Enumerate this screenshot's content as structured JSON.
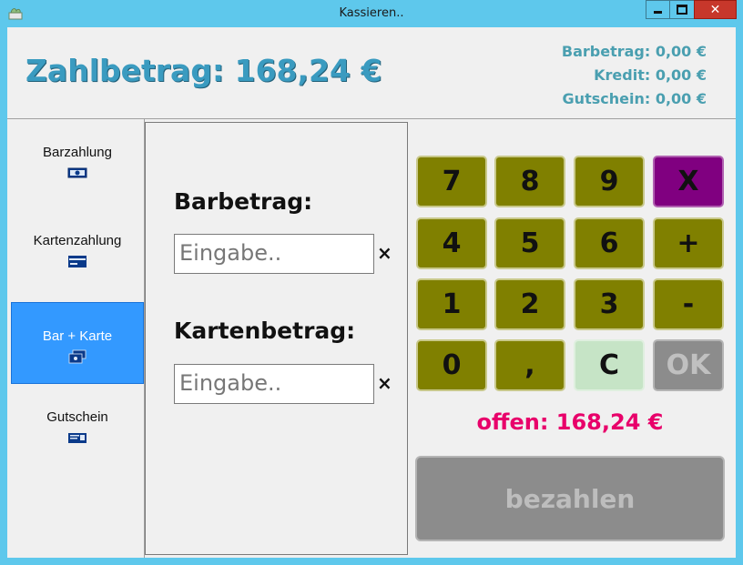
{
  "window": {
    "title": "Kassieren..",
    "close_glyph": "✕"
  },
  "header": {
    "zahlbetrag": "Zahlbetrag: 168,24 €",
    "barbetrag": "Barbetrag: 0,00 €",
    "kredit": "Kredit: 0,00 €",
    "gutschein": "Gutschein: 0,00 €"
  },
  "sidebar": {
    "items": [
      {
        "label": "Barzahlung",
        "icon": "cash-icon",
        "active": false
      },
      {
        "label": "Kartenzahlung",
        "icon": "card-icon",
        "active": false
      },
      {
        "label": "Bar + Karte",
        "icon": "cash-card-icon",
        "active": true
      },
      {
        "label": "Gutschein",
        "icon": "voucher-icon",
        "active": false
      }
    ]
  },
  "form": {
    "barbetrag_label": "Barbetrag:",
    "barbetrag_placeholder": "Eingabe..",
    "kartenbetrag_label": "Kartenbetrag:",
    "kartenbetrag_placeholder": "Eingabe..",
    "clear_glyph": "×"
  },
  "keypad": {
    "keys": [
      "7",
      "8",
      "9",
      "X",
      "4",
      "5",
      "6",
      "+",
      "1",
      "2",
      "3",
      "-",
      "0",
      ",",
      "C",
      "OK"
    ]
  },
  "status": {
    "offen": "offen: 168,24 €"
  },
  "actions": {
    "pay_label": "bezahlen"
  },
  "colors": {
    "titlebar": "#5ec8ec",
    "key_olive": "#808000",
    "key_purple": "#800080",
    "key_clear": "#c6e4c6",
    "disabled_gray": "#8c8c8c",
    "offen_pink": "#e8006a",
    "active_blue": "#3399ff",
    "header_blue": "#3a9bc0"
  }
}
